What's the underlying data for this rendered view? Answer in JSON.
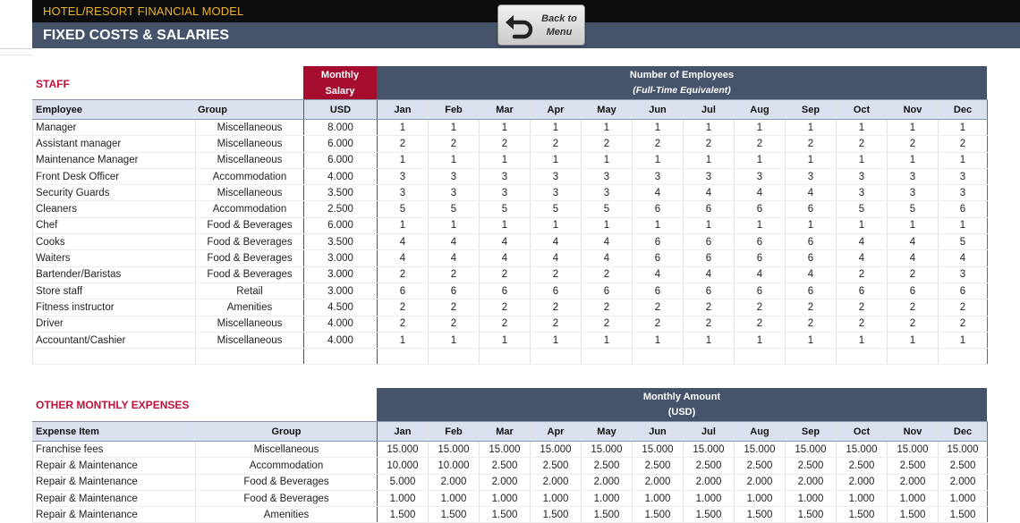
{
  "header": {
    "app_title": "HOTEL/RESORT FINANCIAL MODEL",
    "page_title": "FIXED COSTS & SALARIES",
    "back_button": {
      "line1": "Back to",
      "line2": "Menu"
    }
  },
  "staff": {
    "section_title": "STAFF",
    "salary_band": {
      "line1": "Monthly",
      "line2": "Salary"
    },
    "employees_band": {
      "line1": "Number of Employees",
      "line2": "(Full-Time Equivalent)"
    },
    "columns": {
      "employee": "Employee",
      "group": "Group",
      "usd": "USD"
    },
    "months": [
      "Jan",
      "Feb",
      "Mar",
      "Apr",
      "May",
      "Jun",
      "Jul",
      "Aug",
      "Sep",
      "Oct",
      "Nov",
      "Dec"
    ],
    "rows": [
      {
        "employee": "Manager",
        "group": "Miscellaneous",
        "salary": "8.000",
        "counts": [
          "1",
          "1",
          "1",
          "1",
          "1",
          "1",
          "1",
          "1",
          "1",
          "1",
          "1",
          "1"
        ]
      },
      {
        "employee": "Assistant manager",
        "group": "Miscellaneous",
        "salary": "6.000",
        "counts": [
          "2",
          "2",
          "2",
          "2",
          "2",
          "2",
          "2",
          "2",
          "2",
          "2",
          "2",
          "2"
        ]
      },
      {
        "employee": "Maintenance Manager",
        "group": "Miscellaneous",
        "salary": "6.000",
        "counts": [
          "1",
          "1",
          "1",
          "1",
          "1",
          "1",
          "1",
          "1",
          "1",
          "1",
          "1",
          "1"
        ]
      },
      {
        "employee": "Front Desk Officer",
        "group": "Accommodation",
        "salary": "4.000",
        "counts": [
          "3",
          "3",
          "3",
          "3",
          "3",
          "3",
          "3",
          "3",
          "3",
          "3",
          "3",
          "3"
        ]
      },
      {
        "employee": "Security Guards",
        "group": "Miscellaneous",
        "salary": "3.500",
        "counts": [
          "3",
          "3",
          "3",
          "3",
          "3",
          "4",
          "4",
          "4",
          "4",
          "3",
          "3",
          "3"
        ]
      },
      {
        "employee": "Cleaners",
        "group": "Accommodation",
        "salary": "2.500",
        "counts": [
          "5",
          "5",
          "5",
          "5",
          "5",
          "6",
          "6",
          "6",
          "6",
          "5",
          "5",
          "6"
        ]
      },
      {
        "employee": "Chef",
        "group": "Food & Beverages",
        "salary": "6.000",
        "counts": [
          "1",
          "1",
          "1",
          "1",
          "1",
          "1",
          "1",
          "1",
          "1",
          "1",
          "1",
          "1"
        ]
      },
      {
        "employee": "Cooks",
        "group": "Food & Beverages",
        "salary": "3.500",
        "counts": [
          "4",
          "4",
          "4",
          "4",
          "4",
          "6",
          "6",
          "6",
          "6",
          "4",
          "4",
          "5"
        ]
      },
      {
        "employee": "Waiters",
        "group": "Food & Beverages",
        "salary": "3.000",
        "counts": [
          "4",
          "4",
          "4",
          "4",
          "4",
          "6",
          "6",
          "6",
          "6",
          "4",
          "4",
          "4"
        ]
      },
      {
        "employee": "Bartender/Baristas",
        "group": "Food & Beverages",
        "salary": "3.000",
        "counts": [
          "2",
          "2",
          "2",
          "2",
          "2",
          "4",
          "4",
          "4",
          "4",
          "2",
          "2",
          "3"
        ]
      },
      {
        "employee": "Store staff",
        "group": "Retail",
        "salary": "3.000",
        "counts": [
          "6",
          "6",
          "6",
          "6",
          "6",
          "6",
          "6",
          "6",
          "6",
          "6",
          "6",
          "6"
        ]
      },
      {
        "employee": "Fitness instructor",
        "group": "Amenities",
        "salary": "4.500",
        "counts": [
          "2",
          "2",
          "2",
          "2",
          "2",
          "2",
          "2",
          "2",
          "2",
          "2",
          "2",
          "2"
        ]
      },
      {
        "employee": "Driver",
        "group": "Miscellaneous",
        "salary": "4.000",
        "counts": [
          "2",
          "2",
          "2",
          "2",
          "2",
          "2",
          "2",
          "2",
          "2",
          "2",
          "2",
          "2"
        ]
      },
      {
        "employee": "Accountant/Cashier",
        "group": "Miscellaneous",
        "salary": "4.000",
        "counts": [
          "1",
          "1",
          "1",
          "1",
          "1",
          "1",
          "1",
          "1",
          "1",
          "1",
          "1",
          "1"
        ]
      },
      {
        "employee": "",
        "group": "",
        "salary": "",
        "counts": [
          "",
          "",
          "",
          "",
          "",
          "",
          "",
          "",
          "",
          "",
          "",
          ""
        ]
      }
    ]
  },
  "expenses": {
    "section_title": "OTHER MONTHLY EXPENSES",
    "amount_band": {
      "line1": "Monthly Amount",
      "line2": "(USD)"
    },
    "columns": {
      "item": "Expense Item",
      "group": "Group"
    },
    "months": [
      "Jan",
      "Feb",
      "Mar",
      "Apr",
      "May",
      "Jun",
      "Jul",
      "Aug",
      "Sep",
      "Oct",
      "Nov",
      "Dec"
    ],
    "rows": [
      {
        "item": "Franchise fees",
        "group": "Miscellaneous",
        "amounts": [
          "15.000",
          "15.000",
          "15.000",
          "15.000",
          "15.000",
          "15.000",
          "15.000",
          "15.000",
          "15.000",
          "15.000",
          "15.000",
          "15.000"
        ]
      },
      {
        "item": "Repair & Maintenance",
        "group": "Accommodation",
        "amounts": [
          "10.000",
          "10.000",
          "2.500",
          "2.500",
          "2.500",
          "2.500",
          "2.500",
          "2.500",
          "2.500",
          "2.500",
          "2.500",
          "2.500"
        ]
      },
      {
        "item": "Repair & Maintenance",
        "group": "Food & Beverages",
        "amounts": [
          "5.000",
          "2.000",
          "2.000",
          "2.000",
          "2.000",
          "2.000",
          "2.000",
          "2.000",
          "2.000",
          "2.000",
          "2.000",
          "2.000"
        ]
      },
      {
        "item": "Repair & Maintenance",
        "group": "Food & Beverages",
        "amounts": [
          "1.000",
          "1.000",
          "1.000",
          "1.000",
          "1.000",
          "1.000",
          "1.000",
          "1.000",
          "1.000",
          "1.000",
          "1.000",
          "1.000"
        ]
      },
      {
        "item": "Repair & Maintenance",
        "group": "Amenities",
        "amounts": [
          "1.500",
          "1.500",
          "1.500",
          "1.500",
          "1.500",
          "1.500",
          "1.500",
          "1.500",
          "1.500",
          "1.500",
          "1.500",
          "1.500"
        ]
      }
    ]
  },
  "colors": {
    "header_bar": "#0d0d0d",
    "title_bar": "#45536b",
    "accent_red": "#c0103a",
    "salary_band": "#a50c2e",
    "column_header": "#dbe0ee",
    "app_title_text": "#f0b429"
  }
}
